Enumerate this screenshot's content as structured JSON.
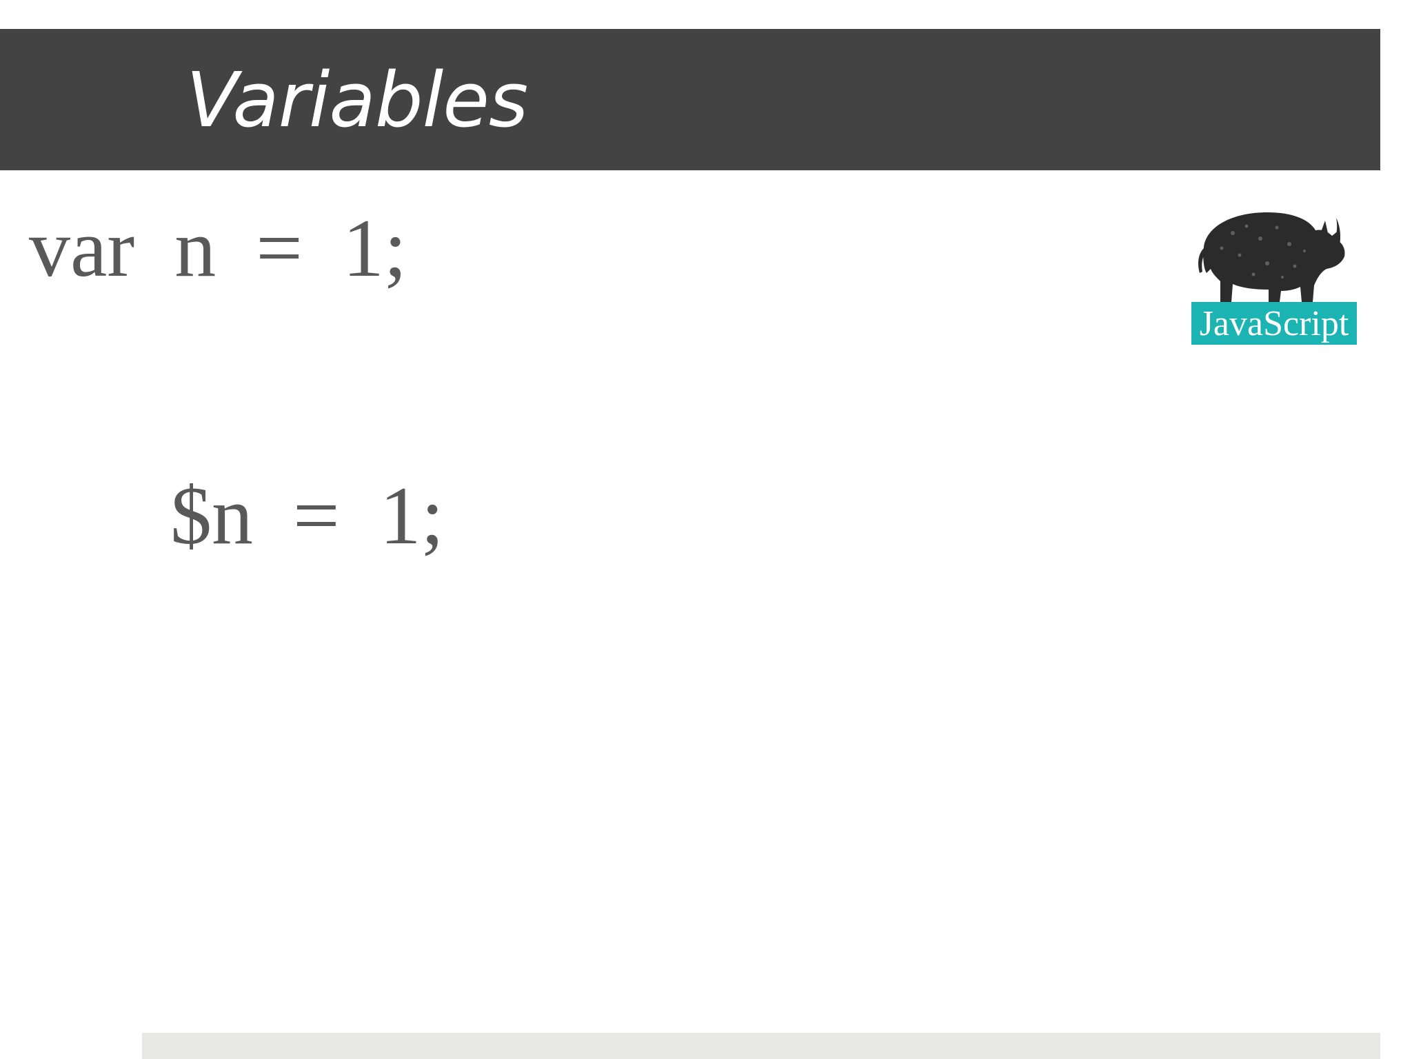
{
  "slide": {
    "title": "Variables",
    "code_lines": [
      "var n = 1;",
      "$n = 1;"
    ]
  },
  "logo": {
    "text": "JavaScript",
    "icon": "rhino-icon",
    "badge_color": "#1cb3b3"
  },
  "colors": {
    "title_bar": "#434343",
    "code_text": "#595959",
    "footer_bar": "#e8e8e6"
  }
}
